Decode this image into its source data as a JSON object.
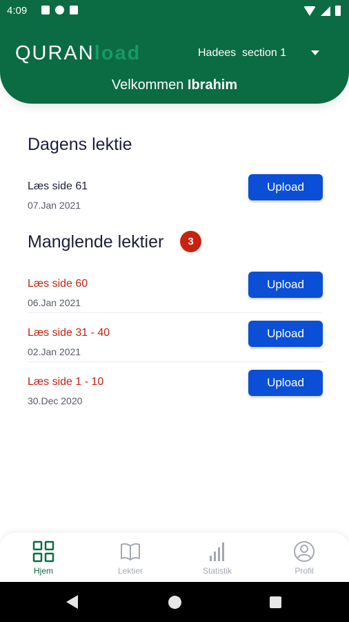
{
  "status_bar": {
    "time": "4:09"
  },
  "header": {
    "brand_part1": "QURAN",
    "brand_part2": "load",
    "section_selected": "Hadees  section 1",
    "welcome_text": "Velkommen ",
    "welcome_name": "Ibrahim",
    "background_color": "#0b6b43"
  },
  "today": {
    "title": "Dagens lektie",
    "item": {
      "label": "Læs side 61",
      "date": "07.Jan 2021",
      "button": "Upload"
    }
  },
  "missing": {
    "title": "Manglende lektier",
    "count": "3",
    "items": [
      {
        "label": "Læs side 60",
        "date": "06.Jan 2021",
        "button": "Upload"
      },
      {
        "label": "Læs side 31 - 40",
        "date": "02.Jan 2021",
        "button": "Upload"
      },
      {
        "label": "Læs side 1 - 10",
        "date": "30.Dec 2020",
        "button": "Upload"
      }
    ]
  },
  "bottom_nav": {
    "items": [
      {
        "label": "Hjem",
        "icon": "grid-icon",
        "active": true
      },
      {
        "label": "Lektier",
        "icon": "book-icon",
        "active": false
      },
      {
        "label": "Statistik",
        "icon": "bar-chart-icon",
        "active": false
      },
      {
        "label": "Profil",
        "icon": "profile-icon",
        "active": false
      }
    ]
  },
  "colors": {
    "accent_green": "#0b6b43",
    "button_blue": "#0a4fd6",
    "missing_red": "#c4200d",
    "badge_red": "#c9230f"
  }
}
